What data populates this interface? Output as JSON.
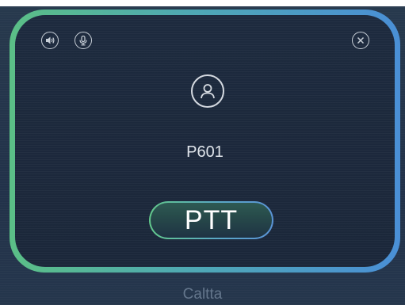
{
  "call_panel": {
    "contact_name": "P601",
    "ptt_label": "PTT"
  },
  "icons": {
    "speaker": "speaker-icon",
    "microphone": "microphone-icon",
    "close": "close-icon",
    "avatar": "user-icon"
  },
  "colors": {
    "border_start": "#5bbf86",
    "border_end": "#4a8fd6",
    "panel_bg": "#1b273a"
  },
  "footer": {
    "app_name": "Caltta"
  }
}
